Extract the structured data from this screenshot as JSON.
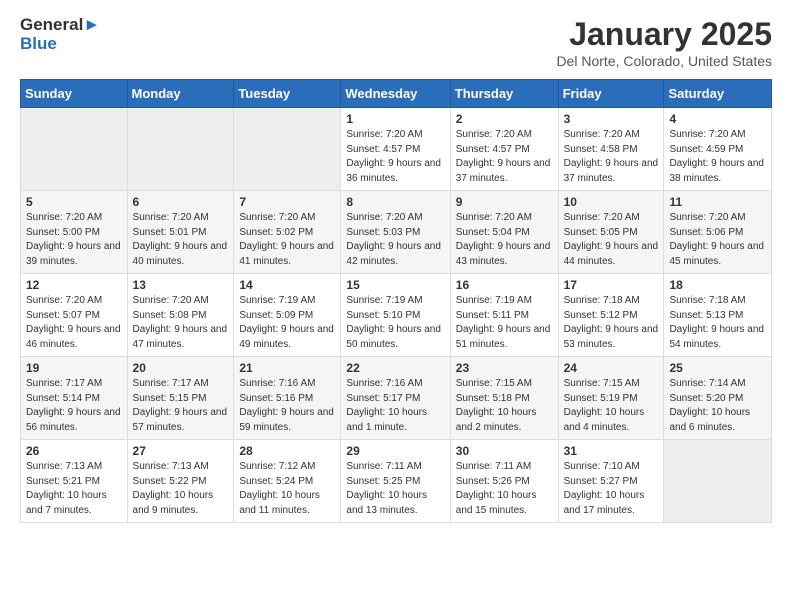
{
  "header": {
    "logo_general": "General",
    "logo_blue": "Blue",
    "month": "January 2025",
    "location": "Del Norte, Colorado, United States"
  },
  "weekdays": [
    "Sunday",
    "Monday",
    "Tuesday",
    "Wednesday",
    "Thursday",
    "Friday",
    "Saturday"
  ],
  "weeks": [
    [
      {
        "day": "",
        "info": ""
      },
      {
        "day": "",
        "info": ""
      },
      {
        "day": "",
        "info": ""
      },
      {
        "day": "1",
        "info": "Sunrise: 7:20 AM\nSunset: 4:57 PM\nDaylight: 9 hours and 36 minutes."
      },
      {
        "day": "2",
        "info": "Sunrise: 7:20 AM\nSunset: 4:57 PM\nDaylight: 9 hours and 37 minutes."
      },
      {
        "day": "3",
        "info": "Sunrise: 7:20 AM\nSunset: 4:58 PM\nDaylight: 9 hours and 37 minutes."
      },
      {
        "day": "4",
        "info": "Sunrise: 7:20 AM\nSunset: 4:59 PM\nDaylight: 9 hours and 38 minutes."
      }
    ],
    [
      {
        "day": "5",
        "info": "Sunrise: 7:20 AM\nSunset: 5:00 PM\nDaylight: 9 hours and 39 minutes."
      },
      {
        "day": "6",
        "info": "Sunrise: 7:20 AM\nSunset: 5:01 PM\nDaylight: 9 hours and 40 minutes."
      },
      {
        "day": "7",
        "info": "Sunrise: 7:20 AM\nSunset: 5:02 PM\nDaylight: 9 hours and 41 minutes."
      },
      {
        "day": "8",
        "info": "Sunrise: 7:20 AM\nSunset: 5:03 PM\nDaylight: 9 hours and 42 minutes."
      },
      {
        "day": "9",
        "info": "Sunrise: 7:20 AM\nSunset: 5:04 PM\nDaylight: 9 hours and 43 minutes."
      },
      {
        "day": "10",
        "info": "Sunrise: 7:20 AM\nSunset: 5:05 PM\nDaylight: 9 hours and 44 minutes."
      },
      {
        "day": "11",
        "info": "Sunrise: 7:20 AM\nSunset: 5:06 PM\nDaylight: 9 hours and 45 minutes."
      }
    ],
    [
      {
        "day": "12",
        "info": "Sunrise: 7:20 AM\nSunset: 5:07 PM\nDaylight: 9 hours and 46 minutes."
      },
      {
        "day": "13",
        "info": "Sunrise: 7:20 AM\nSunset: 5:08 PM\nDaylight: 9 hours and 47 minutes."
      },
      {
        "day": "14",
        "info": "Sunrise: 7:19 AM\nSunset: 5:09 PM\nDaylight: 9 hours and 49 minutes."
      },
      {
        "day": "15",
        "info": "Sunrise: 7:19 AM\nSunset: 5:10 PM\nDaylight: 9 hours and 50 minutes."
      },
      {
        "day": "16",
        "info": "Sunrise: 7:19 AM\nSunset: 5:11 PM\nDaylight: 9 hours and 51 minutes."
      },
      {
        "day": "17",
        "info": "Sunrise: 7:18 AM\nSunset: 5:12 PM\nDaylight: 9 hours and 53 minutes."
      },
      {
        "day": "18",
        "info": "Sunrise: 7:18 AM\nSunset: 5:13 PM\nDaylight: 9 hours and 54 minutes."
      }
    ],
    [
      {
        "day": "19",
        "info": "Sunrise: 7:17 AM\nSunset: 5:14 PM\nDaylight: 9 hours and 56 minutes."
      },
      {
        "day": "20",
        "info": "Sunrise: 7:17 AM\nSunset: 5:15 PM\nDaylight: 9 hours and 57 minutes."
      },
      {
        "day": "21",
        "info": "Sunrise: 7:16 AM\nSunset: 5:16 PM\nDaylight: 9 hours and 59 minutes."
      },
      {
        "day": "22",
        "info": "Sunrise: 7:16 AM\nSunset: 5:17 PM\nDaylight: 10 hours and 1 minute."
      },
      {
        "day": "23",
        "info": "Sunrise: 7:15 AM\nSunset: 5:18 PM\nDaylight: 10 hours and 2 minutes."
      },
      {
        "day": "24",
        "info": "Sunrise: 7:15 AM\nSunset: 5:19 PM\nDaylight: 10 hours and 4 minutes."
      },
      {
        "day": "25",
        "info": "Sunrise: 7:14 AM\nSunset: 5:20 PM\nDaylight: 10 hours and 6 minutes."
      }
    ],
    [
      {
        "day": "26",
        "info": "Sunrise: 7:13 AM\nSunset: 5:21 PM\nDaylight: 10 hours and 7 minutes."
      },
      {
        "day": "27",
        "info": "Sunrise: 7:13 AM\nSunset: 5:22 PM\nDaylight: 10 hours and 9 minutes."
      },
      {
        "day": "28",
        "info": "Sunrise: 7:12 AM\nSunset: 5:24 PM\nDaylight: 10 hours and 11 minutes."
      },
      {
        "day": "29",
        "info": "Sunrise: 7:11 AM\nSunset: 5:25 PM\nDaylight: 10 hours and 13 minutes."
      },
      {
        "day": "30",
        "info": "Sunrise: 7:11 AM\nSunset: 5:26 PM\nDaylight: 10 hours and 15 minutes."
      },
      {
        "day": "31",
        "info": "Sunrise: 7:10 AM\nSunset: 5:27 PM\nDaylight: 10 hours and 17 minutes."
      },
      {
        "day": "",
        "info": ""
      }
    ]
  ]
}
